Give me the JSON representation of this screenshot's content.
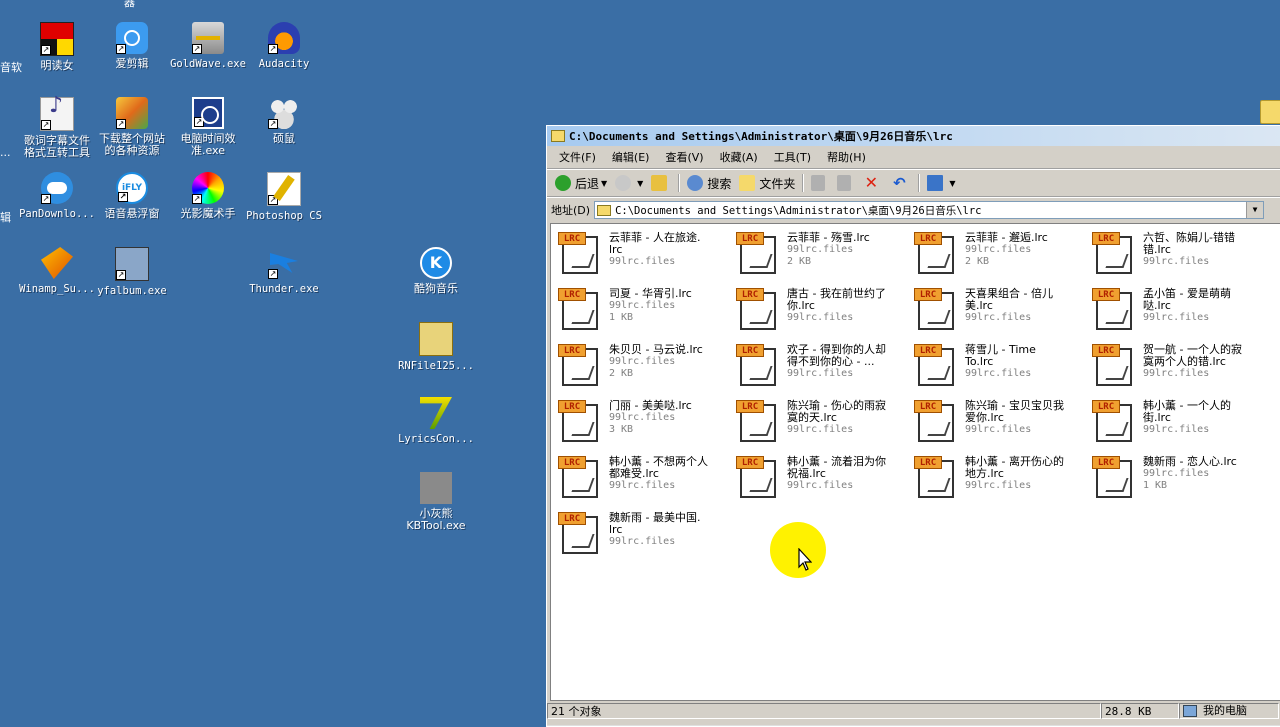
{
  "desktop": {
    "top_clip_label": "器",
    "left_clip_labels": [
      "音软",
      "...",
      "辑"
    ],
    "icons": [
      {
        "label": "明读女"
      },
      {
        "label": "爱剪辑"
      },
      {
        "label": "GoldWave.exe"
      },
      {
        "label": "Audacity"
      },
      {
        "label": "歌词字幕文件\n格式互转工具"
      },
      {
        "label": "下载整个网站\n的各种资源"
      },
      {
        "label": "电脑时间效\n准.exe"
      },
      {
        "label": "硕鼠"
      },
      {
        "label": "PanDownlo..."
      },
      {
        "label": "语音悬浮窗"
      },
      {
        "label": "光影魔术手"
      },
      {
        "label": "Photoshop CS"
      },
      {
        "label": "Winamp_Su..."
      },
      {
        "label": "yfalbum.exe"
      },
      {
        "label": "Thunder.exe"
      },
      {
        "label": "酷狗音乐"
      },
      {
        "label": "RNFile125..."
      },
      {
        "label": "LyricsCon..."
      },
      {
        "label": "小灰熊\nKBTool.exe"
      }
    ]
  },
  "window": {
    "title": "C:\\Documents and Settings\\Administrator\\桌面\\9月26日音乐\\lrc",
    "menu": [
      "文件(F)",
      "编辑(E)",
      "查看(V)",
      "收藏(A)",
      "工具(T)",
      "帮助(H)"
    ],
    "toolbar": {
      "back": "后退",
      "search": "搜索",
      "folders": "文件夹"
    },
    "address_label": "地址(D)",
    "address_value": "C:\\Documents and Settings\\Administrator\\桌面\\9月26日音乐\\lrc",
    "badge": "LRC",
    "files": [
      {
        "name": "云菲菲 - 人在旅途.\nlrc",
        "type": "99lrc.files",
        "size": ""
      },
      {
        "name": "云菲菲 - 殇雪.lrc",
        "type": "99lrc.files",
        "size": "2 KB"
      },
      {
        "name": "云菲菲 - 邂逅.lrc",
        "type": "99lrc.files",
        "size": "2 KB"
      },
      {
        "name": "六哲、陈娟儿-错错\n错.lrc",
        "type": "99lrc.files",
        "size": ""
      },
      {
        "name": "司夏 - 华胥引.lrc",
        "type": "99lrc.files",
        "size": "1 KB"
      },
      {
        "name": "唐古 - 我在前世约了\n你.lrc",
        "type": "99lrc.files",
        "size": ""
      },
      {
        "name": "天喜果组合 - 倍儿\n美.lrc",
        "type": "99lrc.files",
        "size": ""
      },
      {
        "name": "孟小笛 - 爱是萌萌\n哒.lrc",
        "type": "99lrc.files",
        "size": ""
      },
      {
        "name": "朱贝贝 - 马云说.lrc",
        "type": "99lrc.files",
        "size": "2 KB"
      },
      {
        "name": "欢子 - 得到你的人却\n得不到你的心 - ...",
        "type": "99lrc.files",
        "size": ""
      },
      {
        "name": "蒋雪儿 - Time\nTo.lrc",
        "type": "99lrc.files",
        "size": ""
      },
      {
        "name": "贺一航 - 一个人的寂\n寞两个人的错.lrc",
        "type": "99lrc.files",
        "size": ""
      },
      {
        "name": "门丽 - 美美哒.lrc",
        "type": "99lrc.files",
        "size": "3 KB"
      },
      {
        "name": "陈兴瑜 - 伤心的雨寂\n寞的天.lrc",
        "type": "99lrc.files",
        "size": ""
      },
      {
        "name": "陈兴瑜 - 宝贝宝贝我\n爱你.lrc",
        "type": "99lrc.files",
        "size": ""
      },
      {
        "name": "韩小薰 - 一个人的\n街.lrc",
        "type": "99lrc.files",
        "size": ""
      },
      {
        "name": "韩小薰 - 不想两个人\n都难受.lrc",
        "type": "99lrc.files",
        "size": ""
      },
      {
        "name": "韩小薰 - 流着泪为你\n祝福.lrc",
        "type": "99lrc.files",
        "size": ""
      },
      {
        "name": "韩小薰 - 离开伤心的\n地方.lrc",
        "type": "99lrc.files",
        "size": ""
      },
      {
        "name": "魏新雨 - 恋人心.lrc",
        "type": "99lrc.files",
        "size": "1 KB"
      },
      {
        "name": "魏新雨 - 最美中国.\nlrc",
        "type": "99lrc.files",
        "size": ""
      }
    ],
    "status": {
      "count": "21 个对象",
      "size": "28.8 KB",
      "zone": "我的电脑"
    }
  }
}
